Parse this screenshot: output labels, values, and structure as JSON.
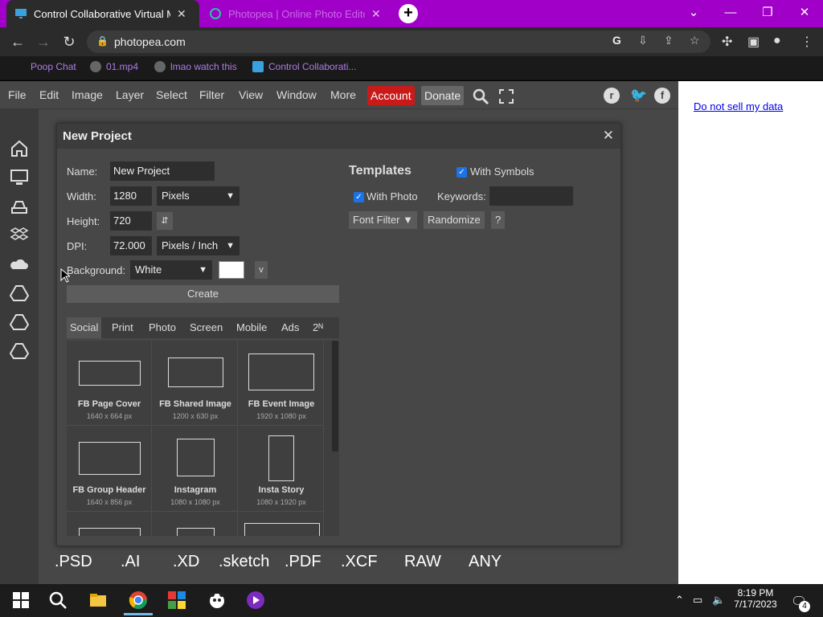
{
  "browser": {
    "tabs": [
      {
        "title": "Control Collaborative Virtual Ma",
        "close": "✕"
      },
      {
        "title": "Photopea | Online Photo Editor",
        "close": "✕"
      }
    ],
    "new_tab": "+",
    "url": "photopea.com",
    "bookmarks": [
      "Poop Chat",
      "01.mp4",
      "lmao watch this",
      "Control Collaborati..."
    ],
    "window_controls": {
      "minimize": "—",
      "restore": "❐",
      "close": "✕",
      "dropdown": "⌄"
    }
  },
  "photopea": {
    "menu": [
      "File",
      "Edit",
      "Image",
      "Layer",
      "Select",
      "Filter",
      "View",
      "Window",
      "More"
    ],
    "account_label": "Account",
    "donate_label": "Donate",
    "do_not_sell": "Do not sell my data",
    "formats": [
      ".PSD",
      ".AI",
      ".XD",
      ".sketch",
      ".PDF",
      ".XCF",
      "RAW",
      "ANY"
    ]
  },
  "dialog": {
    "title": "New Project",
    "close": "✕",
    "name_label": "Name:",
    "name_value": "New Project",
    "width_label": "Width:",
    "width_value": "1280",
    "width_unit": "Pixels",
    "height_label": "Height:",
    "height_value": "720",
    "swap": "⇵",
    "dpi_label": "DPI:",
    "dpi_value": "72.000",
    "dpi_unit": "Pixels / Inch",
    "background_label": "Background:",
    "background_value": "White",
    "bg_more": "v",
    "create_label": "Create",
    "templates_title": "Templates",
    "with_symbols": "With Symbols",
    "with_photo": "With Photo",
    "keywords_label": "Keywords:",
    "font_filter": "Font Filter ▼",
    "randomize": "Randomize",
    "help": "?",
    "categories": [
      "Social",
      "Print",
      "Photo",
      "Screen",
      "Mobile",
      "Ads",
      "2ᴺ"
    ],
    "presets": [
      {
        "name": "FB Page Cover",
        "size": "1640 x 664 px"
      },
      {
        "name": "FB Shared Image",
        "size": "1200 x 630 px"
      },
      {
        "name": "FB Event Image",
        "size": "1920 x 1080 px"
      },
      {
        "name": "FB Group Header",
        "size": "1640 x 856 px"
      },
      {
        "name": "Instagram",
        "size": "1080 x 1080 px"
      },
      {
        "name": "Insta Story",
        "size": "1080 x 1920 px"
      }
    ]
  },
  "taskbar": {
    "time": "8:19 PM",
    "date": "7/17/2023",
    "notifications": "4"
  },
  "colors": {
    "tabbar": "#a100c8",
    "account": "#c91a1a",
    "dialog": "#474747"
  }
}
